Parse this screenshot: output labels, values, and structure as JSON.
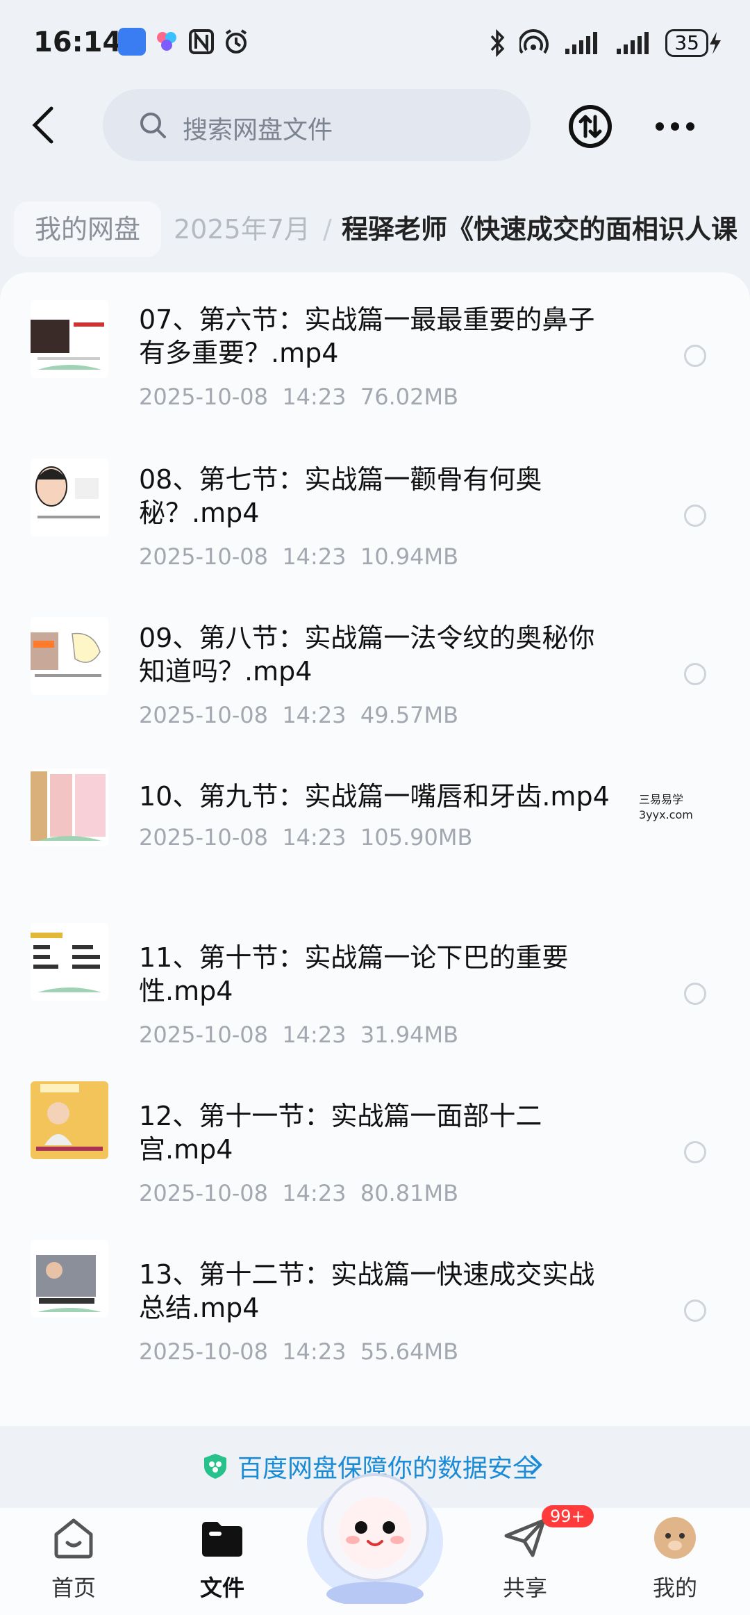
{
  "status_bar": {
    "time": "16:14",
    "battery": "35",
    "icons": [
      "app-u-icon",
      "tricolor-app-icon",
      "nfc-icon",
      "alarm-icon",
      "bluetooth-icon",
      "hotspot-icon",
      "signal-icon",
      "signal-icon",
      "charging-icon"
    ]
  },
  "header": {
    "search_placeholder": "搜索网盘文件",
    "icons": [
      "back-icon",
      "search-icon",
      "transfer-icon",
      "more-icon"
    ]
  },
  "breadcrumb": {
    "items": [
      "我的网盘",
      "2025年7月",
      "程驿老师《快速成交的面相识人课"
    ],
    "separator": "/"
  },
  "files": [
    {
      "name_line1": "07、第六节：实战篇一最最重要的鼻子",
      "name_line2": "有多重要？.mp4",
      "date": "2025-10-08",
      "time": "14:23",
      "size": "76.02MB"
    },
    {
      "name_line1": "08、第七节：实战篇一颧骨有何奥",
      "name_line2": "秘？.mp4",
      "date": "2025-10-08",
      "time": "14:23",
      "size": "10.94MB"
    },
    {
      "name_line1": "09、第八节：实战篇一法令纹的奥秘你",
      "name_line2": "知道吗？.mp4",
      "date": "2025-10-08",
      "time": "14:23",
      "size": "49.57MB"
    },
    {
      "name_line1": "10、第九节：实战篇一嘴唇和牙齿.mp4",
      "name_line2": "",
      "date": "2025-10-08",
      "time": "14:23",
      "size": "105.90MB"
    },
    {
      "name_line1": "11、第十节：实战篇一论下巴的重要",
      "name_line2": "性.mp4",
      "date": "2025-10-08",
      "time": "14:23",
      "size": "31.94MB"
    },
    {
      "name_line1": "12、第十一节：实战篇一面部十二",
      "name_line2": "宫.mp4",
      "date": "2025-10-08",
      "time": "14:23",
      "size": "80.81MB"
    },
    {
      "name_line1": "13、第十二节：实战篇一快速成交实战",
      "name_line2": "总结.mp4",
      "date": "2025-10-08",
      "time": "14:23",
      "size": "55.64MB"
    }
  ],
  "watermark": {
    "line1": "三易易学",
    "line2": "3yyx.com"
  },
  "safety_banner": {
    "text": "百度网盘保障你的数据安全"
  },
  "tabbar": {
    "home": "首页",
    "files": "文件",
    "share": "共享",
    "mine": "我的",
    "share_badge": "99+"
  },
  "colors": {
    "accent_blue": "#1b8bd6",
    "badge_red": "#ff3b3b"
  }
}
